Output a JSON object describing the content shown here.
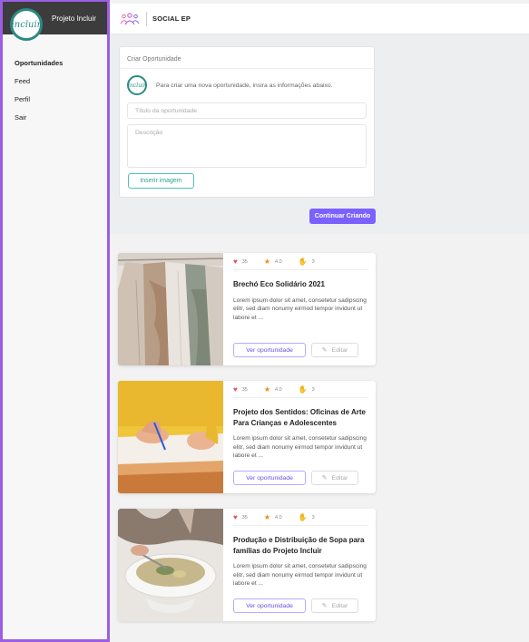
{
  "sidebar": {
    "brand_logo_text": "incluir",
    "brand_name": "Projeto Incluir",
    "items": [
      {
        "label": "Oportunidades",
        "active": true
      },
      {
        "label": "Feed",
        "active": false
      },
      {
        "label": "Perfil",
        "active": false
      },
      {
        "label": "Sair",
        "active": false
      }
    ]
  },
  "topbar": {
    "logo_icon": "social-ep-people-icon",
    "title": "SOCIAL EP"
  },
  "create": {
    "card_title": "Criar Oportunidade",
    "avatar_text": "incluir",
    "hint": "Para criar uma nova oportunidade, insira as informações abaixo.",
    "title_placeholder": "Título da oportunidade",
    "description_placeholder": "Descrição",
    "insert_image_label": "Inserir imagem",
    "continue_label": "Continuar Criando"
  },
  "feed": [
    {
      "likes": "35",
      "rating": "4.0",
      "volunteers": "3",
      "title": "Brechó Eco Solidário 2021",
      "description": "Lorem ipsum dolor sit amet, consetetur sadipscing elitr, sed diam nonumy eirmod tempor invidunt ut labore et ...",
      "view_label": "Ver oportunidade",
      "edit_label": "Editar"
    },
    {
      "likes": "35",
      "rating": "4.0",
      "volunteers": "3",
      "title": "Projeto dos Sentidos: Oficinas de Arte Para Crianças e Adolescentes",
      "description": "Lorem ipsum dolor sit amet, consetetur sadipscing elitr, sed diam nonumy eirmod tempor invidunt ut labore et ...",
      "view_label": "Ver oportunidade",
      "edit_label": "Editar"
    },
    {
      "likes": "35",
      "rating": "4.0",
      "volunteers": "3",
      "title": "Produção e Distribuição de Sopa para famílias do Projeto Incluir",
      "description": "Lorem ipsum dolor sit amet, consetetur sadipscing elitr, sed diam nonumy eirmod tempor invidunt ut labore et ...",
      "view_label": "Ver oportunidade",
      "edit_label": "Editar"
    }
  ],
  "colors": {
    "accent": "#7b61ff",
    "sidebar_border": "#9b5de5",
    "brand_teal": "#2d8a84",
    "heart": "#e8505b",
    "star": "#f28a1d"
  }
}
